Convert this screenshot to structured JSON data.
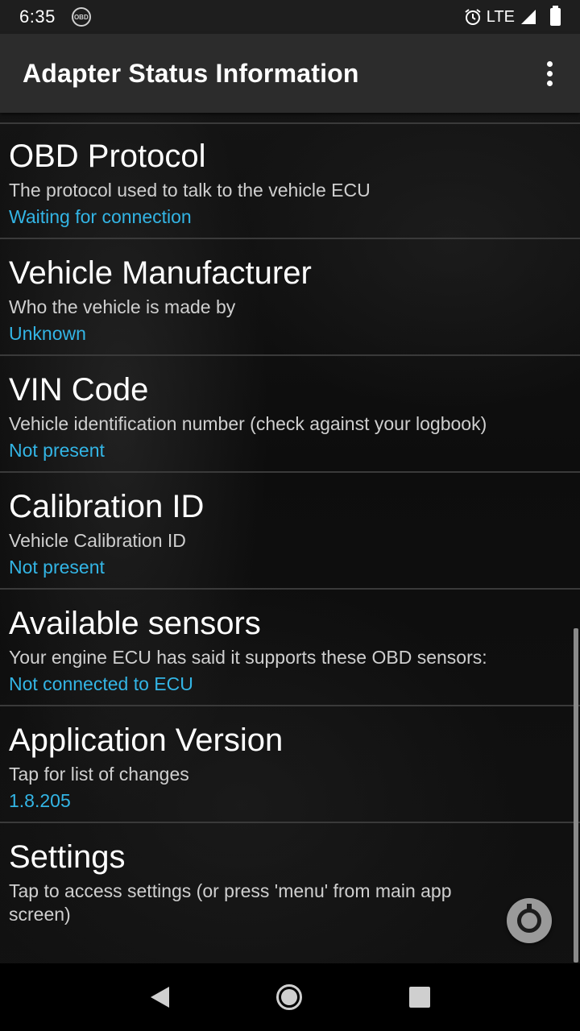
{
  "status_bar": {
    "time": "6:35",
    "obd_badge": "OBD",
    "network": "LTE",
    "icons": [
      "obd-icon",
      "alarm-icon",
      "signal-icon",
      "battery-icon"
    ]
  },
  "app_bar": {
    "title": "Adapter Status Information"
  },
  "colors": {
    "accent": "#33b5e5",
    "app_bar": "#2c2c2c",
    "status_bar": "#1e1e1e"
  },
  "items": [
    {
      "title": "OBD Protocol",
      "summary": "The protocol used to talk to the vehicle ECU",
      "value": "Waiting for connection"
    },
    {
      "title": "Vehicle Manufacturer",
      "summary": "Who the vehicle is made by",
      "value": "Unknown"
    },
    {
      "title": "VIN Code",
      "summary": "Vehicle identification number (check against your logbook)",
      "value": "Not present"
    },
    {
      "title": "Calibration ID",
      "summary": "Vehicle Calibration ID",
      "value": "Not present"
    },
    {
      "title": "Available sensors",
      "summary": "Your engine ECU has said it supports these OBD sensors:",
      "value": "Not connected to ECU"
    },
    {
      "title": "Application Version",
      "summary": "Tap for list of changes",
      "value": "1.8.205"
    },
    {
      "title": "Settings",
      "summary": "Tap to access settings (or press 'menu' from main app screen)",
      "value": ""
    }
  ]
}
